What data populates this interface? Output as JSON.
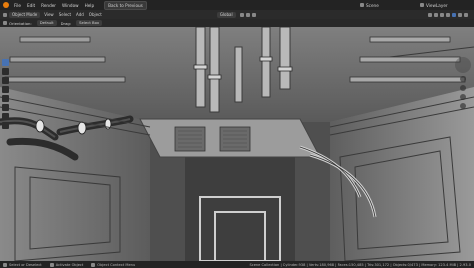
{
  "menu": {
    "items": [
      "File",
      "Edit",
      "Render",
      "Window",
      "Help"
    ],
    "back_button": "Back to Previous",
    "scene_label": "Scene",
    "viewlayer_label": "ViewLayer"
  },
  "header": {
    "mode": "Object Mode",
    "menus": [
      "View",
      "Select",
      "Add",
      "Object"
    ],
    "orientation": "Global"
  },
  "tool_settings": {
    "orientation_label": "Orientation:",
    "orientation_value": "Default",
    "drag_label": "Drag:",
    "drag_value": "Select Box"
  },
  "status": {
    "left": "Select or Deselect",
    "middle": "Activate Object",
    "right_hint": "Object Context Menu",
    "stats": "Scene Collection | Cylinder.938 | Verts:180,968 | Faces:150,485 | Tris:301,172 | Objects:0/473 | Memory: 123.4 MiB | 2.93.0"
  },
  "colors": {
    "accent": "#4772b3",
    "logo": "#e87d0d",
    "viewport_bg": "#6d6d6d"
  }
}
